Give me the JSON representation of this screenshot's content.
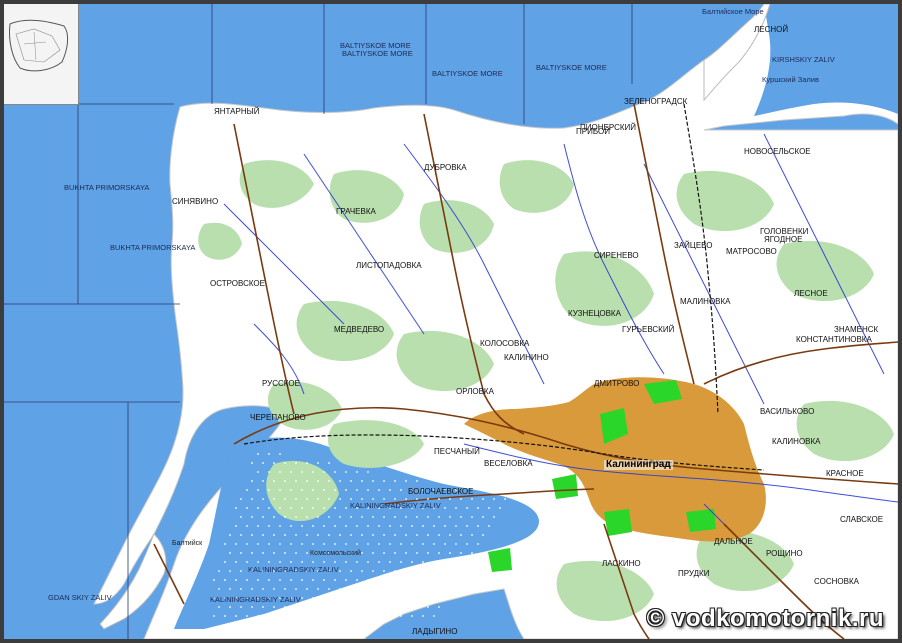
{
  "colors": {
    "sea": "#5fa2e6",
    "land": "#ffffff",
    "forest": "#b9dfae",
    "urban": "#d89a3a",
    "park": "#2ad62a",
    "road": "#7a3a10",
    "river": "#2a3ad6",
    "grid": "#2a3a6a",
    "frame": "#3c3c3c"
  },
  "watermark": "© vodkomotornik.ru",
  "city_label": "Калининград",
  "sea_labels": [
    "BALTIYSKOE MORE",
    "BALTIYSKOE MORE",
    "BALTIYSKOE MORE",
    "BALTIYSKOE MORE",
    "Балтийское Море",
    "KIRSHSKIY ZALIV",
    "Куршский Залив",
    "BUKHTA PRIMORSKAYA",
    "BUKHTA PRIMORSKAYA",
    "KALININGRADSKIY ZALIV",
    "KALININGRADSKIY ZALIV",
    "KALININGRADSKIY ZALIV",
    "GDAN SKIY ZALIV"
  ],
  "place_labels": [
    "ЛЕСНОЙ",
    "ЯНТАРНЫЙ",
    "СИНЯВИНО",
    "ОСТРОВСКОЕ",
    "МЕДВЕДЕВО",
    "ДУБРОВКА",
    "ГРАЧЕВКА",
    "ЛИСТОПАДОВКА",
    "ЗАЙЦЕВО",
    "МАТРОСОВО",
    "СИРЕНЕВО",
    "КУЗНЕЦОВКА",
    "ГУРЬЕВСКИЙ",
    "ЛЕСНОЕ",
    "МАЛИНОВКА",
    "ЗЕЛЕНОГРАДСК",
    "ЯГОДНОЕ",
    "ОРЛОВКА",
    "КОЛОСОВКА",
    "КАЛИНИНО",
    "ДМИТРОВО",
    "ВЕСЕЛОВКА",
    "ПЕСЧАНЫЙ",
    "ЧЕРЕПАНОВО",
    "РУССКОЕ",
    "КАЛИНОВКА",
    "КРАСНОЕ",
    "СЛАВСКОЕ",
    "СОСНОВКА",
    "РОЩИНО",
    "ДАЛЬНОЕ",
    "ПРУДКИ",
    "ЛАСКИНО",
    "ВОЛОЧАЕВСКОЕ",
    "Комсомольский",
    "Балтийск",
    "ЗНАМЕНСК",
    "ВАСИЛЬКОВО",
    "КОНСТАНТИНОВКА",
    "НОВОСЕЛЬСКОЕ",
    "ПИОНЕРСКИЙ",
    "ГОЛОВЕНКИ",
    "ПРИБОЙ",
    "ЛАДЫГИНО"
  ],
  "inset": {
    "label": ""
  }
}
